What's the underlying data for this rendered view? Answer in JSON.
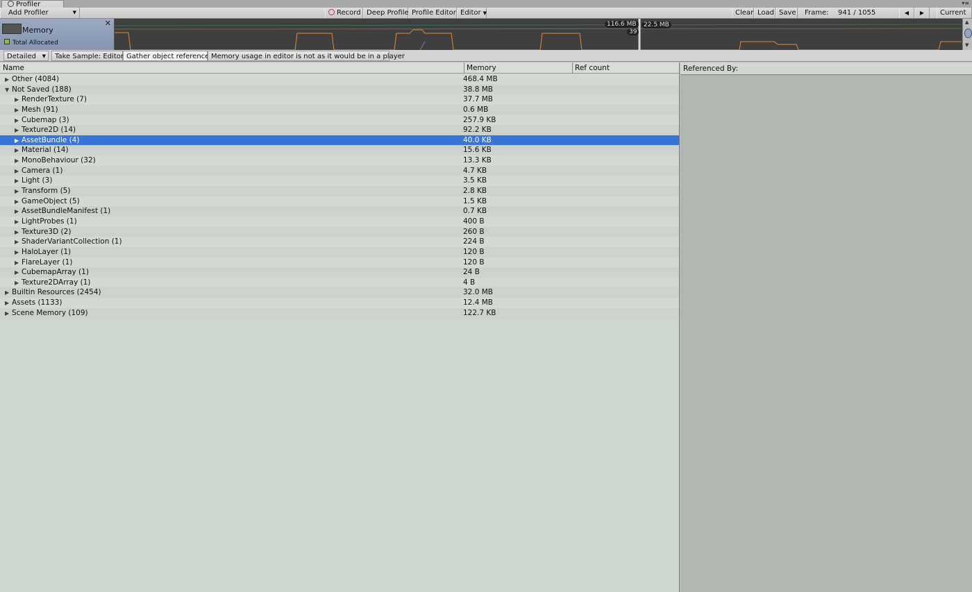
{
  "window": {
    "tab_title": "Profiler",
    "menu_glyph": "▾≡"
  },
  "toolbar": {
    "add_profiler": "Add Profiler",
    "record": "Record",
    "deep_profile": "Deep Profile",
    "profile_editor": "Profile Editor",
    "target": "Editor",
    "clear": "Clear",
    "load": "Load",
    "save": "Save",
    "frame_label": "Frame:",
    "frame_value": "941 / 1055",
    "prev": "◀",
    "next": "▶",
    "current": "Current"
  },
  "graph": {
    "module_title": "Memory",
    "legend_total": "Total Allocated",
    "tag_total": "116.6 MB",
    "tag_count": "39",
    "tag_other": "22.5 MB",
    "colors": {
      "accent": "#e08a2c",
      "legend": "#8fbd3a",
      "line": "#4a8a6a"
    }
  },
  "detailbar": {
    "mode": "Detailed",
    "take_sample": "Take Sample: Editor",
    "gather_refs": "Gather object references",
    "warning": "Memory usage in editor is not as it would be in a player"
  },
  "tree": {
    "columns": {
      "name": "Name",
      "memory": "Memory",
      "ref_count": "Ref count"
    },
    "rows": [
      {
        "name": "Other (4084)",
        "memory": "468.4 MB",
        "level": 0,
        "expanded": false
      },
      {
        "name": "Not Saved (188)",
        "memory": "38.8 MB",
        "level": 0,
        "expanded": true
      },
      {
        "name": "RenderTexture (7)",
        "memory": "37.7 MB",
        "level": 1,
        "expanded": false
      },
      {
        "name": "Mesh (91)",
        "memory": "0.6 MB",
        "level": 1,
        "expanded": false
      },
      {
        "name": "Cubemap (3)",
        "memory": "257.9 KB",
        "level": 1,
        "expanded": false
      },
      {
        "name": "Texture2D (14)",
        "memory": "92.2 KB",
        "level": 1,
        "expanded": false
      },
      {
        "name": "AssetBundle (4)",
        "memory": "40.0 KB",
        "level": 1,
        "expanded": false,
        "selected": true
      },
      {
        "name": "Material (14)",
        "memory": "15.6 KB",
        "level": 1,
        "expanded": false
      },
      {
        "name": "MonoBehaviour (32)",
        "memory": "13.3 KB",
        "level": 1,
        "expanded": false
      },
      {
        "name": "Camera (1)",
        "memory": "4.7 KB",
        "level": 1,
        "expanded": false
      },
      {
        "name": "Light (3)",
        "memory": "3.5 KB",
        "level": 1,
        "expanded": false
      },
      {
        "name": "Transform (5)",
        "memory": "2.8 KB",
        "level": 1,
        "expanded": false
      },
      {
        "name": "GameObject (5)",
        "memory": "1.5 KB",
        "level": 1,
        "expanded": false
      },
      {
        "name": "AssetBundleManifest (1)",
        "memory": "0.7 KB",
        "level": 1,
        "expanded": false
      },
      {
        "name": "LightProbes (1)",
        "memory": "400 B",
        "level": 1,
        "expanded": false
      },
      {
        "name": "Texture3D (2)",
        "memory": "260 B",
        "level": 1,
        "expanded": false
      },
      {
        "name": "ShaderVariantCollection (1)",
        "memory": "224 B",
        "level": 1,
        "expanded": false
      },
      {
        "name": "HaloLayer (1)",
        "memory": "120 B",
        "level": 1,
        "expanded": false
      },
      {
        "name": "FlareLayer (1)",
        "memory": "120 B",
        "level": 1,
        "expanded": false
      },
      {
        "name": "CubemapArray (1)",
        "memory": "24 B",
        "level": 1,
        "expanded": false
      },
      {
        "name": "Texture2DArray (1)",
        "memory": "4 B",
        "level": 1,
        "expanded": false
      },
      {
        "name": "Builtin Resources (2454)",
        "memory": "32.0 MB",
        "level": 0,
        "expanded": false
      },
      {
        "name": "Assets (1133)",
        "memory": "12.4 MB",
        "level": 0,
        "expanded": false
      },
      {
        "name": "Scene Memory (109)",
        "memory": "122.7 KB",
        "level": 0,
        "expanded": false
      }
    ]
  },
  "ref_panel": {
    "header": "Referenced By:"
  },
  "colors": {
    "selection": "#3875d7",
    "tree_bg": "#cfd6d0",
    "ref_bg": "#b2b6b0"
  }
}
